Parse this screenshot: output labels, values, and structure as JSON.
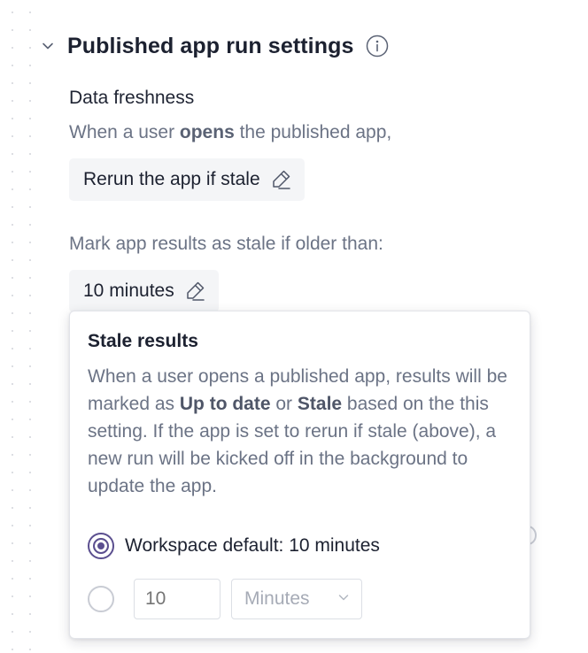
{
  "section": {
    "title": "Published app run settings",
    "info_icon": "info-icon",
    "collapse_icon": "chevron-down-icon"
  },
  "data_freshness": {
    "label": "Data freshness",
    "desc_prefix": "When a user ",
    "desc_bold": "opens",
    "desc_suffix": " the published app,",
    "rerun_value": "Rerun the app if stale",
    "edit_icon": "pencil-icon"
  },
  "stale_threshold": {
    "label": "Mark app results as stale if older than:",
    "value": "10 minutes",
    "edit_icon": "pencil-icon"
  },
  "popover": {
    "title": "Stale results",
    "body_1": "When a user opens a published app, results will be marked as ",
    "body_bold_1": "Up to date",
    "body_2": " or ",
    "body_bold_2": "Stale",
    "body_3": " based on the this setting. If the app is set to rerun if stale (above), a new run will be kicked off in the background to update the app.",
    "options": {
      "default_label": "Workspace default: 10 minutes",
      "custom_value_placeholder": "10",
      "custom_unit": "Minutes"
    }
  },
  "colors": {
    "accent": "#5b4f8f",
    "muted_text": "#6b7385",
    "chip_bg": "#f4f5f7"
  }
}
